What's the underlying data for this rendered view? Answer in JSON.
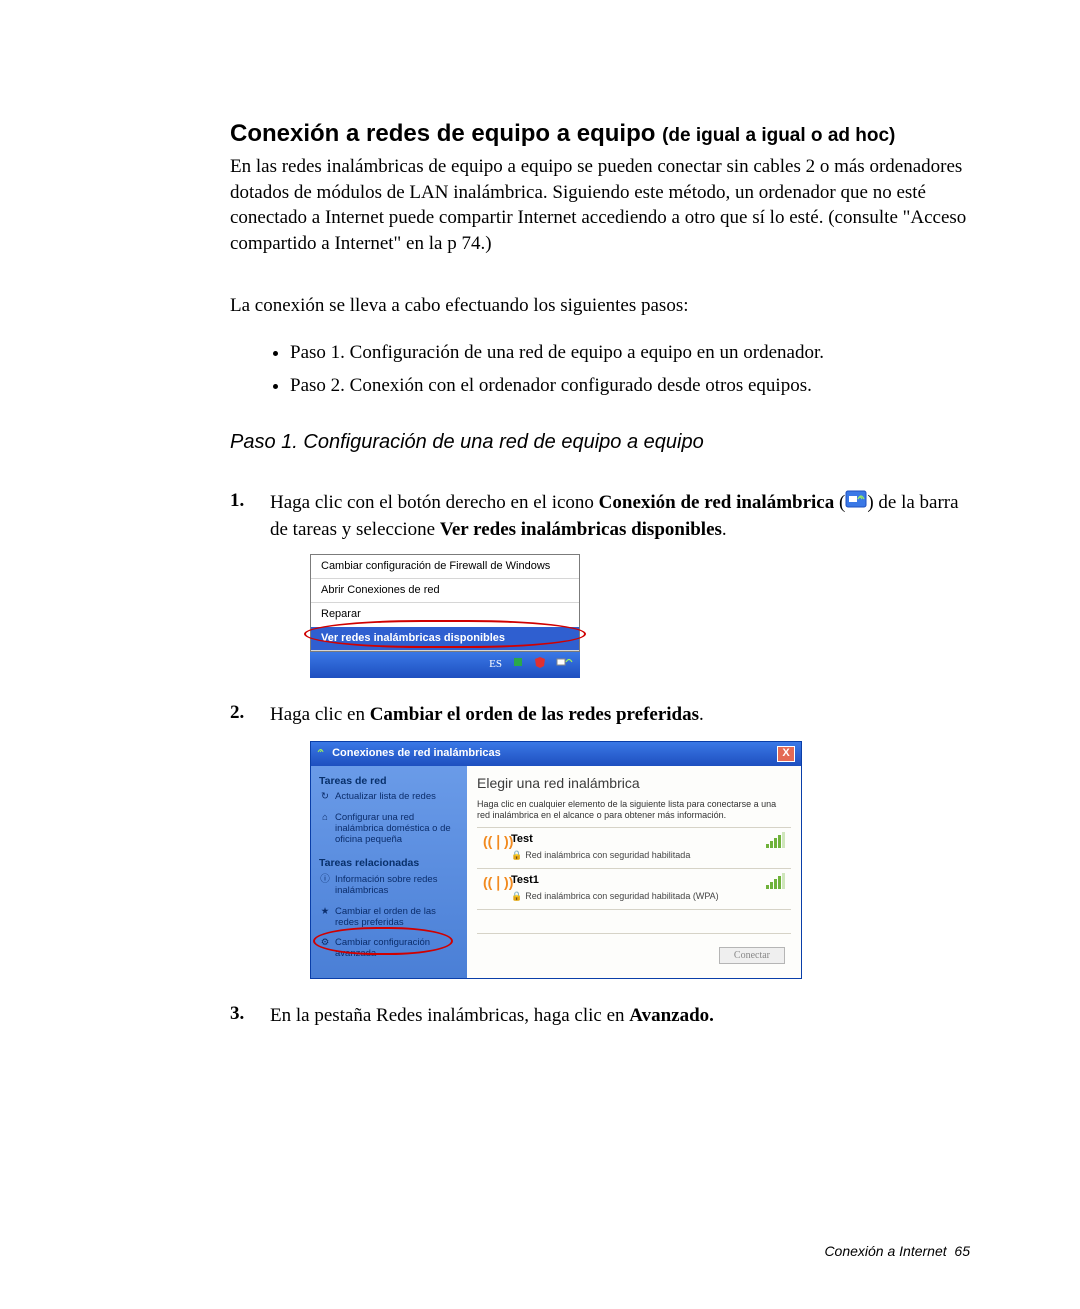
{
  "heading": {
    "main": "Conexión a redes de equipo a equipo ",
    "sub": "(de igual a igual o ad hoc)"
  },
  "intro": "En las redes inalámbricas de equipo a equipo se pueden conectar sin cables 2 o más ordenadores dotados de módulos de LAN inalámbrica. Siguiendo este método, un ordenador que no esté conectado a Internet puede compartir Internet accediendo a otro que sí lo esté. (consulte \"Acceso compartido a Internet\" en la p 74.)",
  "lead": "La conexión se lleva a cabo efectuando los siguientes pasos:",
  "bullets": [
    "Paso 1. Configuración de una red de equipo a equipo en un ordenador.",
    "Paso 2. Conexión con el ordenador configurado desde otros equipos."
  ],
  "step_heading": "Paso 1. Configuración de una red de equipo a equipo",
  "steps": {
    "s1_num": "1.",
    "s1_a": "Haga clic con el botón derecho en el icono ",
    "s1_b": "Conexión de red inalámbrica",
    "s1_c": " (",
    "s1_d": ") de la barra de tareas y seleccione ",
    "s1_e": "Ver redes inalámbricas disponibles",
    "s1_f": ".",
    "s2_num": "2.",
    "s2_a": "Haga clic en ",
    "s2_b": "Cambiar el orden de las redes preferidas",
    "s2_c": ".",
    "s3_num": "3.",
    "s3_a": "En la pestaña Redes inalámbricas, haga clic en ",
    "s3_b": "Avanzado.",
    "s3_c": ""
  },
  "ctx_menu": {
    "i1": "Cambiar configuración de Firewall de Windows",
    "i2": "Abrir Conexiones de red",
    "i3": "Reparar",
    "i4": "Ver redes inalámbricas disponibles"
  },
  "taskbar": {
    "lang": "ES"
  },
  "win": {
    "title": "Conexiones de red inalámbricas",
    "close": "X",
    "side": {
      "g1": "Tareas de red",
      "l1": "Actualizar lista de redes",
      "l2": "Configurar una red inalámbrica doméstica o de oficina pequeña",
      "g2": "Tareas relacionadas",
      "l3": "Información sobre redes inalámbricas",
      "l4": "Cambiar el orden de las redes preferidas",
      "l5": "Cambiar configuración avanzada"
    },
    "main": {
      "h": "Elegir una red inalámbrica",
      "hint": "Haga clic en cualquier elemento de la siguiente lista para conectarse a una red inalámbrica en el alcance o para obtener más información.",
      "n1": {
        "name": "Test",
        "sec": "Red inalámbrica con seguridad habilitada"
      },
      "n2": {
        "name": "Test1",
        "sec": "Red inalámbrica con seguridad habilitada (WPA)"
      },
      "connect": "Conectar"
    }
  },
  "footer": {
    "label": "Conexión a Internet",
    "page": "65"
  }
}
